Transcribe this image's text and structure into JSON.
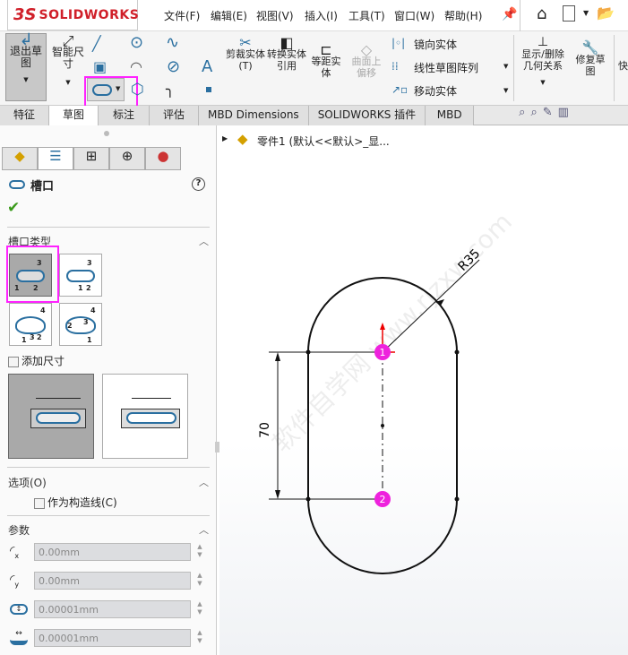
{
  "app": {
    "logo_ds": "3S",
    "logo_text": "SOLIDWORKS"
  },
  "menu": [
    "文件(F)",
    "编辑(E)",
    "视图(V)",
    "插入(I)",
    "工具(T)",
    "窗口(W)",
    "帮助(H)"
  ],
  "ribbon": {
    "exit_sketch": "退出草图",
    "smart_dim": "智能尺寸",
    "trim": "剪裁实体(T)",
    "convert": "转换实体引用",
    "offset": "等距实体",
    "surface_offset": "曲面上偏移",
    "mirror": "镜向实体",
    "linear_pattern": "线性草图阵列",
    "move": "移动实体",
    "show_relations": "显示/删除几何关系",
    "repair": "修复草图",
    "quick": "快"
  },
  "tabs": [
    "特征",
    "草图",
    "标注",
    "评估",
    "MBD Dimensions",
    "SOLIDWORKS 插件",
    "MBD"
  ],
  "tree": {
    "part": "零件1 (默认<<默认>_显..."
  },
  "panel": {
    "title": "槽口",
    "help": "?",
    "slot_type": "槽口类型",
    "slot_labels": [
      [
        "1",
        "2",
        "3"
      ],
      [
        "1",
        "2",
        "3"
      ],
      [
        "1",
        "3",
        "2",
        "4"
      ],
      [
        "2",
        "3",
        "4",
        "1"
      ]
    ],
    "add_dim": "添加尺寸",
    "options": "选项(O)",
    "construction": "作为构造线(C)",
    "params": "参数",
    "fields": [
      "0.00mm",
      "0.00mm",
      "0.00001mm",
      "0.00001mm"
    ]
  },
  "sketch": {
    "radius_dim": "R35",
    "length_dim": "70",
    "point1": "1",
    "point2": "2"
  },
  "watermark": "软件自学网 www.rjzxw.com",
  "colors": {
    "accent": "#ff22ff",
    "slot_blue": "#2a6fa0",
    "check": "#3a9a1a"
  }
}
